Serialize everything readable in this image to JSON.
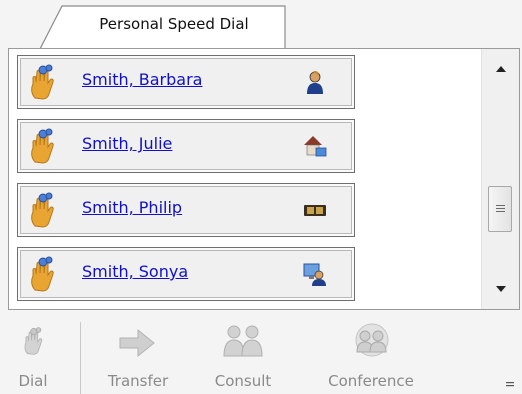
{
  "tab": {
    "label": "Personal Speed Dial"
  },
  "contacts": [
    {
      "name": "Smith, Barbara",
      "status": "present-person-icon"
    },
    {
      "name": "Smith, Julie",
      "status": "at-home-icon"
    },
    {
      "name": "Smith, Philip",
      "status": "do-not-disturb-icon"
    },
    {
      "name": "Smith, Sonya",
      "status": "at-computer-icon"
    }
  ],
  "toolbar": {
    "dial": "Dial",
    "transfer": "Transfer",
    "consult": "Consult",
    "conference": "Conference"
  },
  "colors": {
    "link": "#1010cc",
    "disabled_text": "#8a8a8a",
    "hand": "#e8a532",
    "phone": "#4a7fd4"
  }
}
